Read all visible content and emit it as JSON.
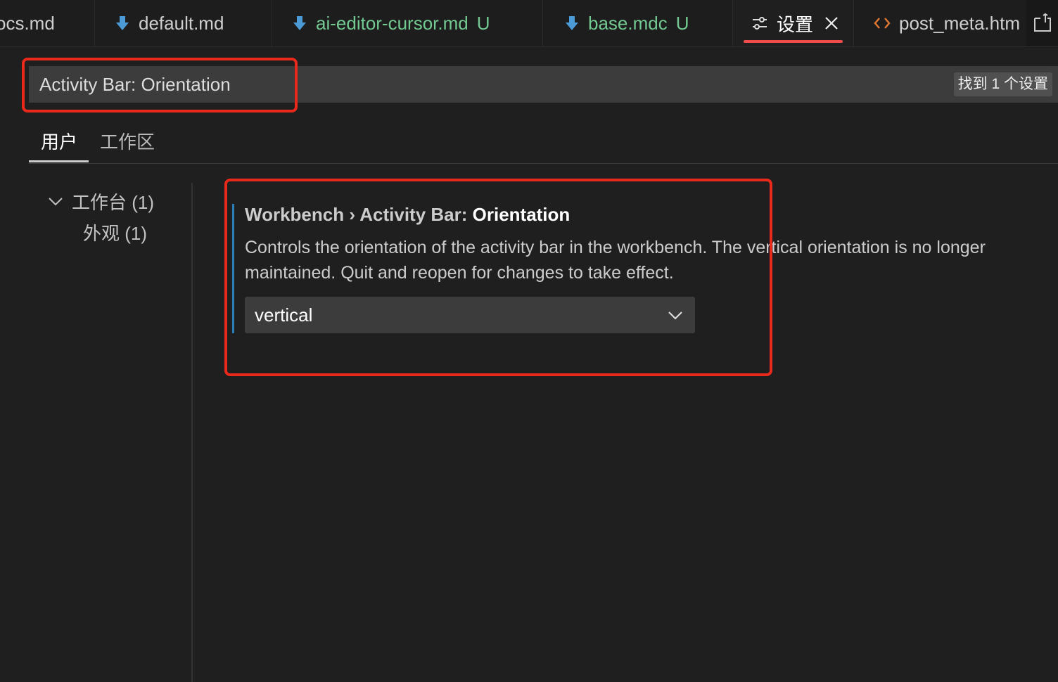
{
  "tabs": [
    {
      "label": "ocs.md",
      "icon": "",
      "dirty": "",
      "active": false
    },
    {
      "label": "default.md",
      "icon": "markdown-download-icon",
      "dirty": "",
      "active": false
    },
    {
      "label": "ai-editor-cursor.md",
      "icon": "markdown-download-icon",
      "dirty": "U",
      "active": false
    },
    {
      "label": "base.mdc",
      "icon": "markdown-download-icon",
      "dirty": "U",
      "active": false
    },
    {
      "label": "设置",
      "icon": "settings-sliders-icon",
      "dirty": "",
      "active": true
    },
    {
      "label": "post_meta.htm",
      "icon": "code-brackets-icon",
      "dirty": "",
      "active": false
    }
  ],
  "colors": {
    "accent_red": "#e8291b",
    "blue_bar": "#2a7fb8",
    "untracked_green": "#73c991",
    "html_icon": "#e37933"
  },
  "search": {
    "value": "Activity Bar: Orientation",
    "result_count": "找到 1 个设置"
  },
  "scope_tabs": [
    {
      "label": "用户",
      "active": true
    },
    {
      "label": "工作区",
      "active": false
    }
  ],
  "toc": [
    {
      "label": "工作台 (1)",
      "expanded": true
    },
    {
      "label": "外观 (1)"
    }
  ],
  "setting": {
    "category": "Workbench › Activity Bar: ",
    "name": "Orientation",
    "description_line1": "Controls the orientation of the activity bar in the workbench. The vertical orientation is no longer",
    "description_line2": "maintained. Quit and reopen for changes to take effect.",
    "value": "vertical"
  }
}
